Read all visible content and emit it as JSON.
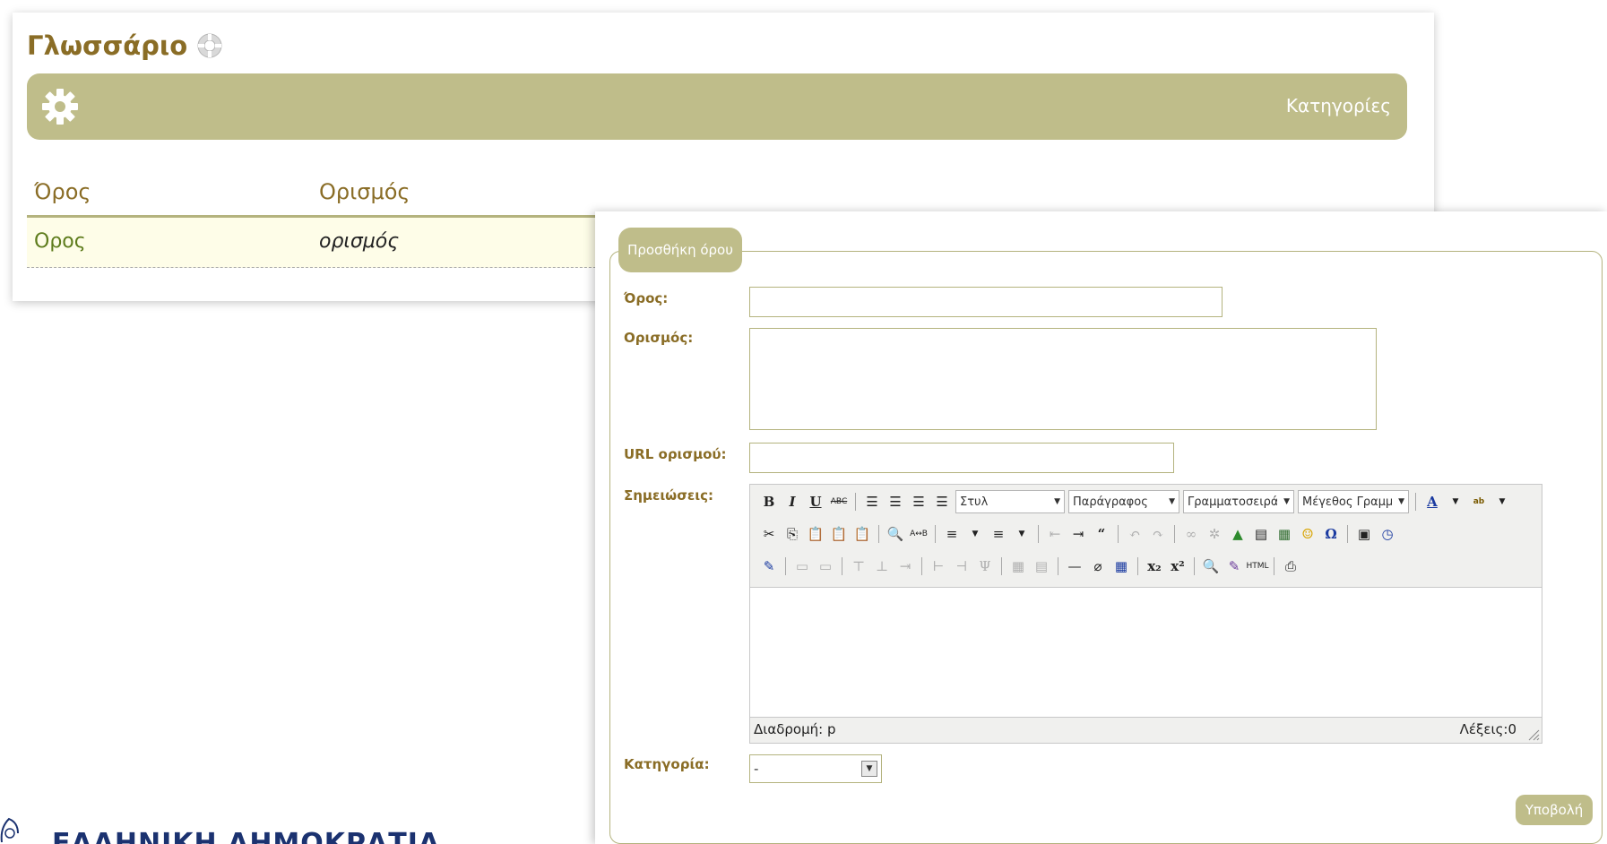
{
  "glossary": {
    "title": "Γλωσσάριο",
    "categories_link": "Κατηγορίες",
    "columns": [
      "Όρος",
      "Ορισμός"
    ],
    "rows": [
      {
        "term": "Ορος",
        "definition": "ορισμός"
      }
    ]
  },
  "dialog": {
    "legend": "Προσθήκη όρου",
    "term_label": "Όρος:",
    "definition_label": "Ορισμός:",
    "url_label": "URL ορισμού:",
    "notes_label": "Σημειώσεις:",
    "category_label": "Κατηγορία:",
    "category_value": "-",
    "submit_label": "Υποβολή",
    "term_value": "",
    "definition_value": "",
    "url_value": ""
  },
  "editor": {
    "style_select": "Στυλ",
    "format_select": "Παράγραφος",
    "font_select": "Γραμματοσειρά",
    "size_select": "Μέγεθος Γραμμ",
    "path_status": "Διαδρομή: p",
    "word_count": "Λέξεις:0"
  },
  "footer": {
    "org_name": "ΕΛΛΗΝΙΚΗ ΔΗΜΟΚΡΑΤΙΑ"
  },
  "colors": {
    "accent": "#bfbd8a",
    "label": "#8a6d26",
    "term_link": "#5e7c1c",
    "footer_text": "#1b3270"
  }
}
